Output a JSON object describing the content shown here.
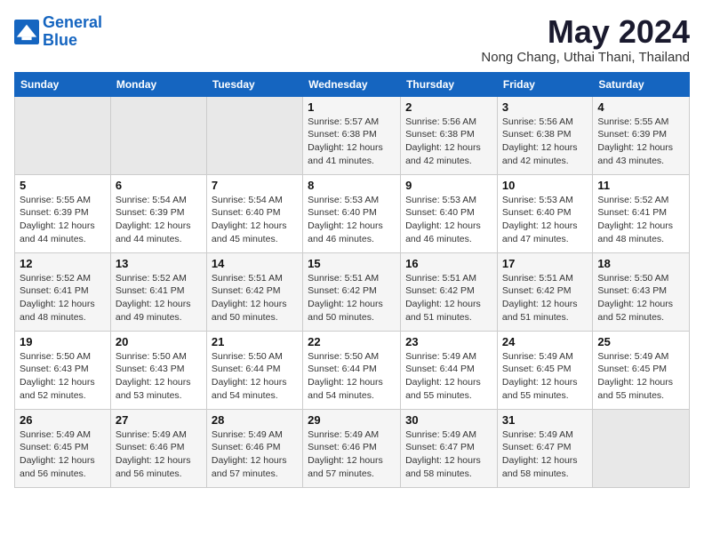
{
  "logo": {
    "line1": "General",
    "line2": "Blue"
  },
  "title": "May 2024",
  "location": "Nong Chang, Uthai Thani, Thailand",
  "weekdays": [
    "Sunday",
    "Monday",
    "Tuesday",
    "Wednesday",
    "Thursday",
    "Friday",
    "Saturday"
  ],
  "weeks": [
    [
      {
        "num": "",
        "sunrise": "",
        "sunset": "",
        "daylight": ""
      },
      {
        "num": "",
        "sunrise": "",
        "sunset": "",
        "daylight": ""
      },
      {
        "num": "",
        "sunrise": "",
        "sunset": "",
        "daylight": ""
      },
      {
        "num": "1",
        "sunrise": "5:57 AM",
        "sunset": "6:38 PM",
        "daylight": "12 hours and 41 minutes."
      },
      {
        "num": "2",
        "sunrise": "5:56 AM",
        "sunset": "6:38 PM",
        "daylight": "12 hours and 42 minutes."
      },
      {
        "num": "3",
        "sunrise": "5:56 AM",
        "sunset": "6:38 PM",
        "daylight": "12 hours and 42 minutes."
      },
      {
        "num": "4",
        "sunrise": "5:55 AM",
        "sunset": "6:39 PM",
        "daylight": "12 hours and 43 minutes."
      }
    ],
    [
      {
        "num": "5",
        "sunrise": "5:55 AM",
        "sunset": "6:39 PM",
        "daylight": "12 hours and 44 minutes."
      },
      {
        "num": "6",
        "sunrise": "5:54 AM",
        "sunset": "6:39 PM",
        "daylight": "12 hours and 44 minutes."
      },
      {
        "num": "7",
        "sunrise": "5:54 AM",
        "sunset": "6:40 PM",
        "daylight": "12 hours and 45 minutes."
      },
      {
        "num": "8",
        "sunrise": "5:53 AM",
        "sunset": "6:40 PM",
        "daylight": "12 hours and 46 minutes."
      },
      {
        "num": "9",
        "sunrise": "5:53 AM",
        "sunset": "6:40 PM",
        "daylight": "12 hours and 46 minutes."
      },
      {
        "num": "10",
        "sunrise": "5:53 AM",
        "sunset": "6:40 PM",
        "daylight": "12 hours and 47 minutes."
      },
      {
        "num": "11",
        "sunrise": "5:52 AM",
        "sunset": "6:41 PM",
        "daylight": "12 hours and 48 minutes."
      }
    ],
    [
      {
        "num": "12",
        "sunrise": "5:52 AM",
        "sunset": "6:41 PM",
        "daylight": "12 hours and 48 minutes."
      },
      {
        "num": "13",
        "sunrise": "5:52 AM",
        "sunset": "6:41 PM",
        "daylight": "12 hours and 49 minutes."
      },
      {
        "num": "14",
        "sunrise": "5:51 AM",
        "sunset": "6:42 PM",
        "daylight": "12 hours and 50 minutes."
      },
      {
        "num": "15",
        "sunrise": "5:51 AM",
        "sunset": "6:42 PM",
        "daylight": "12 hours and 50 minutes."
      },
      {
        "num": "16",
        "sunrise": "5:51 AM",
        "sunset": "6:42 PM",
        "daylight": "12 hours and 51 minutes."
      },
      {
        "num": "17",
        "sunrise": "5:51 AM",
        "sunset": "6:42 PM",
        "daylight": "12 hours and 51 minutes."
      },
      {
        "num": "18",
        "sunrise": "5:50 AM",
        "sunset": "6:43 PM",
        "daylight": "12 hours and 52 minutes."
      }
    ],
    [
      {
        "num": "19",
        "sunrise": "5:50 AM",
        "sunset": "6:43 PM",
        "daylight": "12 hours and 52 minutes."
      },
      {
        "num": "20",
        "sunrise": "5:50 AM",
        "sunset": "6:43 PM",
        "daylight": "12 hours and 53 minutes."
      },
      {
        "num": "21",
        "sunrise": "5:50 AM",
        "sunset": "6:44 PM",
        "daylight": "12 hours and 54 minutes."
      },
      {
        "num": "22",
        "sunrise": "5:50 AM",
        "sunset": "6:44 PM",
        "daylight": "12 hours and 54 minutes."
      },
      {
        "num": "23",
        "sunrise": "5:49 AM",
        "sunset": "6:44 PM",
        "daylight": "12 hours and 55 minutes."
      },
      {
        "num": "24",
        "sunrise": "5:49 AM",
        "sunset": "6:45 PM",
        "daylight": "12 hours and 55 minutes."
      },
      {
        "num": "25",
        "sunrise": "5:49 AM",
        "sunset": "6:45 PM",
        "daylight": "12 hours and 55 minutes."
      }
    ],
    [
      {
        "num": "26",
        "sunrise": "5:49 AM",
        "sunset": "6:45 PM",
        "daylight": "12 hours and 56 minutes."
      },
      {
        "num": "27",
        "sunrise": "5:49 AM",
        "sunset": "6:46 PM",
        "daylight": "12 hours and 56 minutes."
      },
      {
        "num": "28",
        "sunrise": "5:49 AM",
        "sunset": "6:46 PM",
        "daylight": "12 hours and 57 minutes."
      },
      {
        "num": "29",
        "sunrise": "5:49 AM",
        "sunset": "6:46 PM",
        "daylight": "12 hours and 57 minutes."
      },
      {
        "num": "30",
        "sunrise": "5:49 AM",
        "sunset": "6:47 PM",
        "daylight": "12 hours and 58 minutes."
      },
      {
        "num": "31",
        "sunrise": "5:49 AM",
        "sunset": "6:47 PM",
        "daylight": "12 hours and 58 minutes."
      },
      {
        "num": "",
        "sunrise": "",
        "sunset": "",
        "daylight": ""
      }
    ]
  ]
}
